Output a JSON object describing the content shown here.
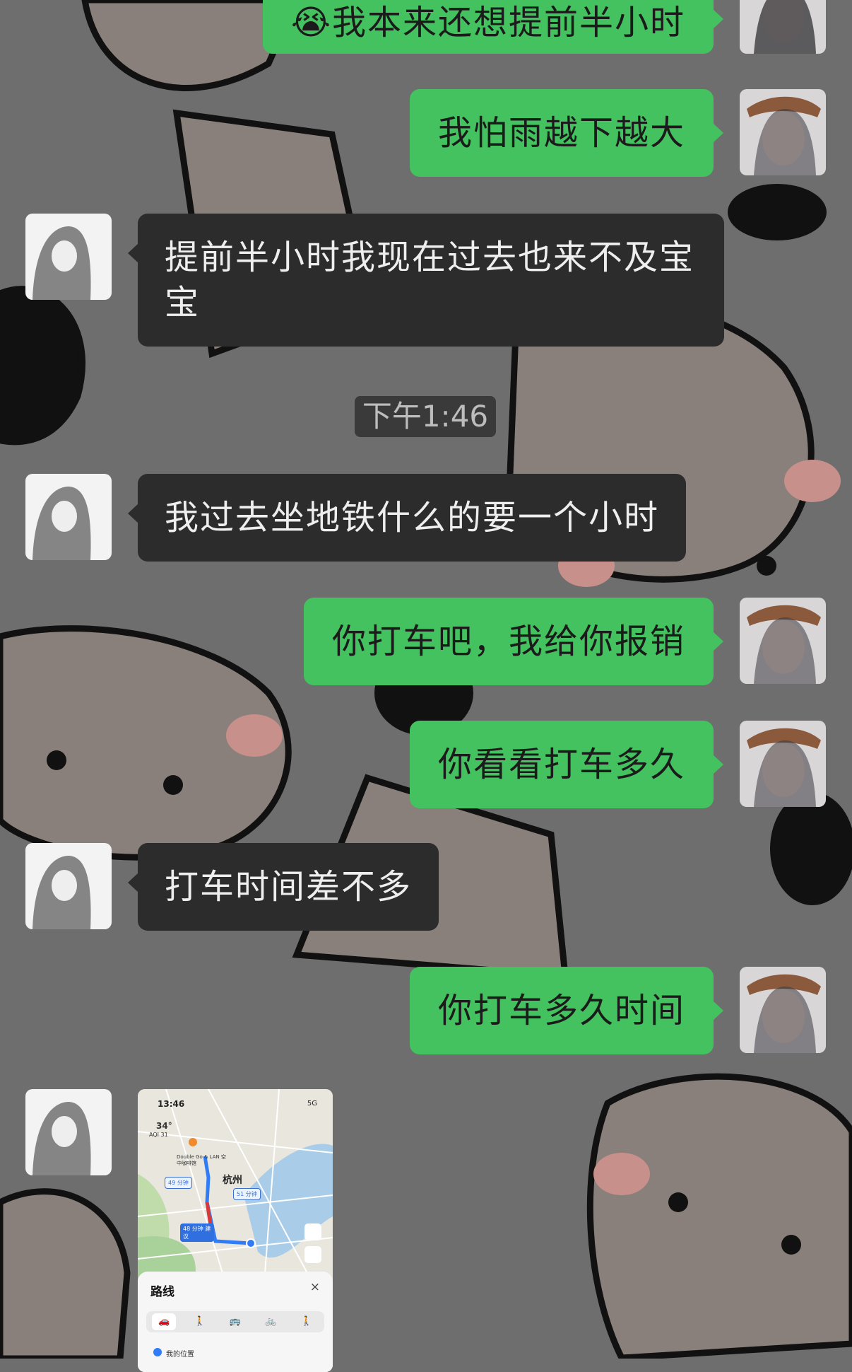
{
  "timestamp": "下午1:46",
  "messages": [
    {
      "side": "me",
      "text": "😭我本来还想提前半小时"
    },
    {
      "side": "me",
      "text": "我怕雨越下越大"
    },
    {
      "side": "them",
      "text": "提前半小时我现在过去也来不及宝宝"
    },
    {
      "side": "them",
      "text": "我过去坐地铁什么的要一个小时"
    },
    {
      "side": "me",
      "text": "你打车吧，我给你报销"
    },
    {
      "side": "me",
      "text": "你看看打车多久"
    },
    {
      "side": "them",
      "text": "打车时间差不多"
    },
    {
      "side": "me",
      "text": "你打车多久时间"
    }
  ],
  "map_screenshot": {
    "status_time": "13:46",
    "signal": "5G",
    "temperature": "34°",
    "aqi": "AQI 31",
    "poi": "Double Go & LAN 空中咖啡馆",
    "city": "杭州",
    "route_badges": [
      "49 分钟",
      "51 分钟",
      "48 分钟 建议"
    ],
    "panel_title": "路线",
    "close": "×",
    "modes": [
      "🚗",
      "🚶",
      "🚌",
      "🚲",
      "🚶"
    ],
    "my_location": "我的位置"
  },
  "colors": {
    "background": "#6f6e6e",
    "my_bubble": "#43c25f",
    "their_bubble": "#2c2c2c"
  }
}
